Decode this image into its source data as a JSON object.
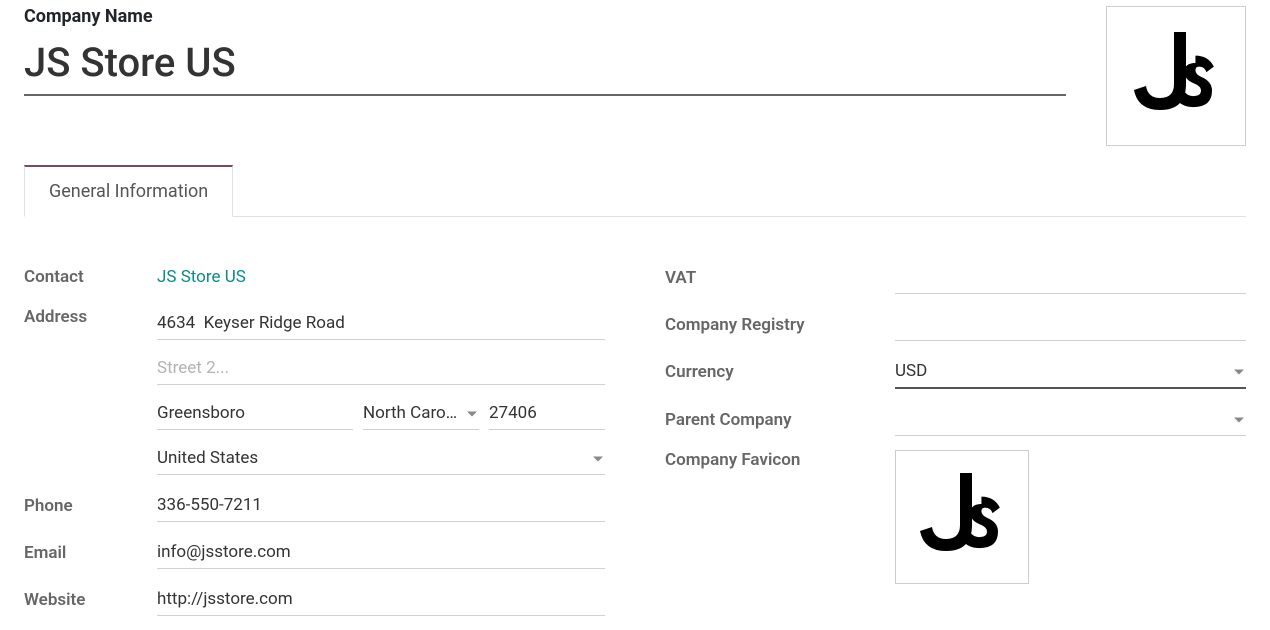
{
  "header": {
    "field_label": "Company Name",
    "company_name": "JS Store US"
  },
  "tabs": {
    "general_info": "General Information"
  },
  "labels": {
    "contact": "Contact",
    "address": "Address",
    "phone": "Phone",
    "email": "Email",
    "website": "Website",
    "vat": "VAT",
    "company_registry": "Company Registry",
    "currency": "Currency",
    "parent_company": "Parent Company",
    "company_favicon": "Company Favicon"
  },
  "contact": {
    "name": "JS Store US"
  },
  "address": {
    "street1": "4634  Keyser Ridge Road",
    "street2_placeholder": "Street 2...",
    "city": "Greensboro",
    "state": "North Carolina (U",
    "zip": "27406",
    "country": "United States"
  },
  "phone": "336-550-7211",
  "email": "info@jsstore.com",
  "website": "http://jsstore.com",
  "vat": "",
  "company_registry": "",
  "currency": "USD",
  "parent_company": ""
}
